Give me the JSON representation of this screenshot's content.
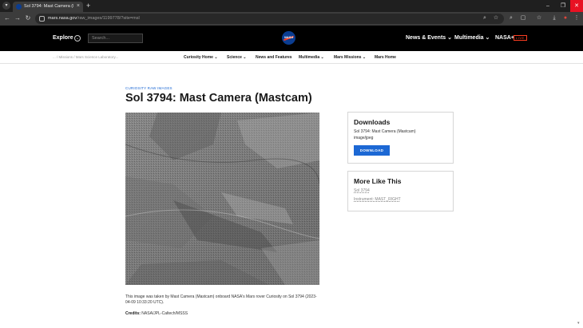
{
  "browser": {
    "tab_title": "Sol 3794: Mast Camera (Mastcam)",
    "tab_close": "×",
    "new_tab": "+",
    "url_host": "mars.nasa.gov",
    "url_path": "/raw_images/1199778/?site=msl",
    "window_controls": {
      "minimize": "–",
      "maximize": "❐",
      "close": "✕"
    }
  },
  "header": {
    "explore_label": "Explore",
    "search_placeholder": "Search...",
    "logo_text": "NASA",
    "links": [
      "News & Events",
      "Multimedia",
      "NASA+"
    ],
    "live_badge": "LIVE"
  },
  "subnav": {
    "breadcrumbs": "...  /  Missions  /  Mars Science Laboratory...",
    "links": [
      "Curiosity Home",
      "Science",
      "News and Features",
      "Multimedia",
      "Mars Missions",
      "Mars Home"
    ]
  },
  "main": {
    "eyebrow": "CURIOSITY RAW IMAGES",
    "title": "Sol 3794: Mast Camera (Mastcam)",
    "caption": "This image was taken by Mast Camera (Mastcam) onboard NASA's Mars rover Curiosity on Sol 3794 (2023-04-09 10:33:20 UTC).",
    "credits_label": "Credits:",
    "credits_value": "NASA/JPL-Caltech/MSSS"
  },
  "downloads": {
    "title": "Downloads",
    "file_name": "Sol 3794: Mast Camera (Mastcam)",
    "file_type": "image/jpeg",
    "button_label": "DOWNLOAD"
  },
  "more_like_this": {
    "title": "More Like This",
    "links": [
      "Sol 3794",
      "Instrument: MAST_RIGHT"
    ]
  },
  "colors": {
    "accent": "#1c68d4",
    "header_bg": "#000000",
    "nasa_blue": "#0b3d91",
    "nasa_red": "#fc3d21"
  }
}
